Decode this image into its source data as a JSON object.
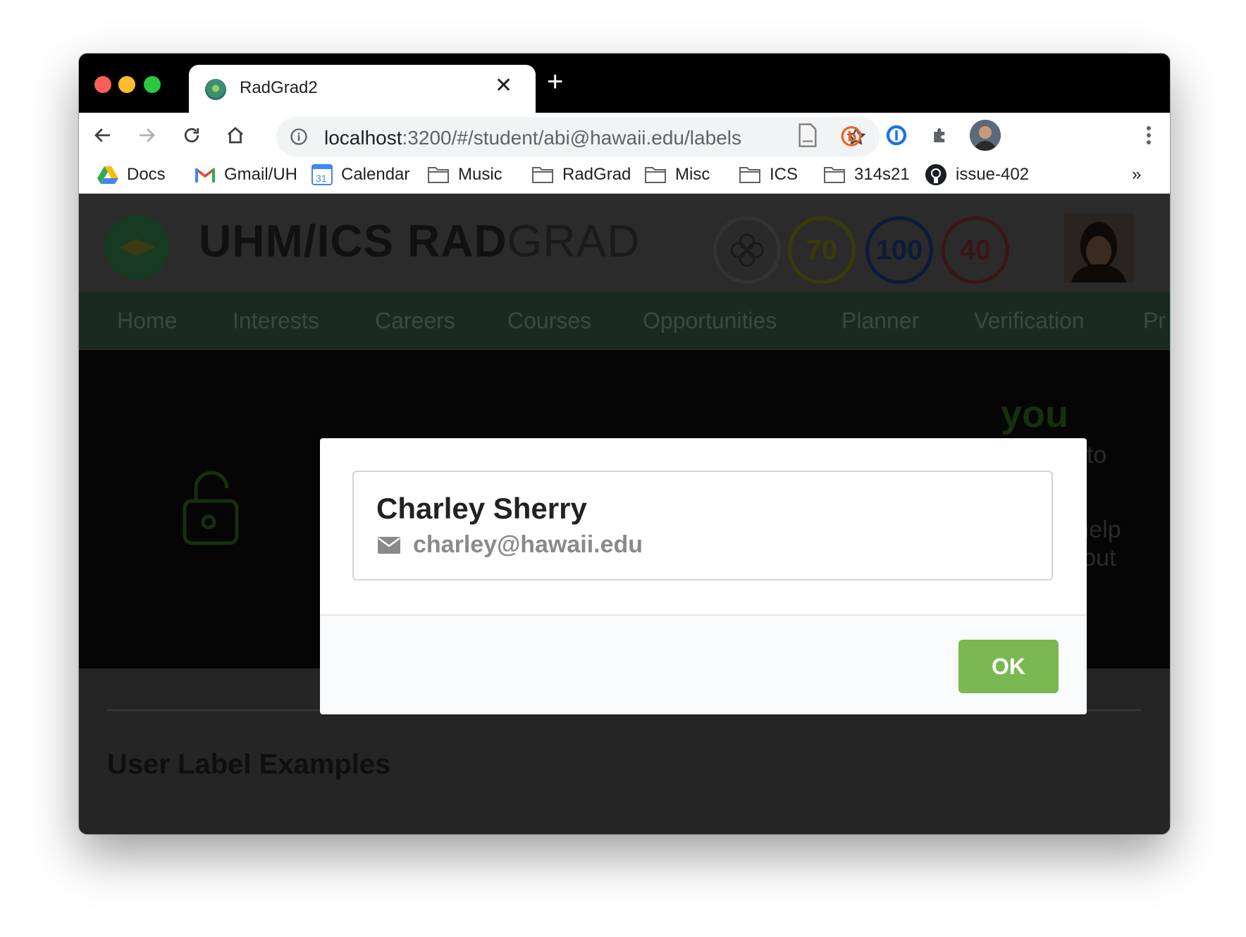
{
  "browser": {
    "tab_title": "RadGrad2",
    "tab_close": "✕",
    "new_tab": "+",
    "url_host": "localhost",
    "url_path": ":3200/#/student/abi@hawaii.edu/labels",
    "bookmarks": [
      {
        "label": "Docs",
        "icon": "google-drive-icon"
      },
      {
        "label": "Gmail/UH",
        "icon": "gmail-icon"
      },
      {
        "label": "Calendar",
        "icon": "calendar-icon"
      },
      {
        "label": "Music",
        "icon": "folder-icon"
      },
      {
        "label": "RadGrad",
        "icon": "folder-icon"
      },
      {
        "label": "Misc",
        "icon": "folder-icon"
      },
      {
        "label": "ICS",
        "icon": "folder-icon"
      },
      {
        "label": "314s21",
        "icon": "folder-icon"
      },
      {
        "label": "issue-402",
        "icon": "github-icon"
      }
    ],
    "bookmarks_overflow": "»",
    "calendar_day": "31",
    "traffic_light_colors": [
      "#ff5f57",
      "#febc2e",
      "#28c840"
    ]
  },
  "site": {
    "title_bold": "UHM/ICS RAD",
    "title_light": "GRAD",
    "gauges": [
      {
        "label": "70",
        "color": "#5a5a12"
      },
      {
        "label": "100",
        "color": "#0e1a3a"
      },
      {
        "label": "40",
        "color": "#4a1a1a"
      }
    ],
    "nav": [
      "Home",
      "Interests",
      "Careers",
      "Courses",
      "Opportunities",
      "Planner",
      "Verification",
      "Pr"
    ],
    "background_fragments": [
      "you",
      "visible to",
      "rad to help",
      "or opt-out"
    ],
    "section_title": "User Label Examples"
  },
  "modal": {
    "name": "Charley Sherry",
    "email": "charley@hawaii.edu",
    "ok_label": "OK",
    "ok_color": "#7ab851"
  }
}
